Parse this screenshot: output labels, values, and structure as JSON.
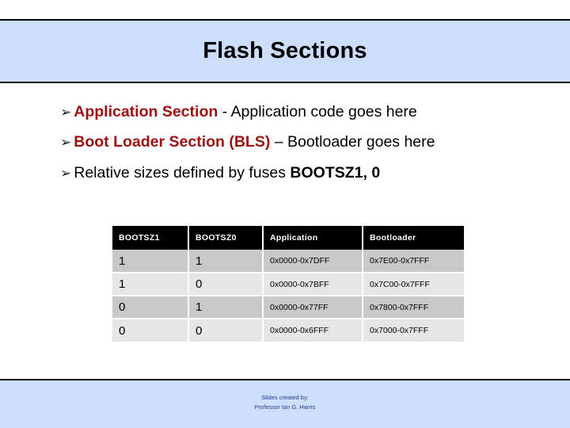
{
  "slide": {
    "title": "Flash Sections",
    "bullet_glyph": "➢",
    "accent_red": "#9e1010",
    "band_color": "#cddefc",
    "bullets": [
      {
        "lead": "Application Section",
        "lead_style": "red-bold",
        "rest": " - Application code goes here",
        "tail": "",
        "tail_style": "none"
      },
      {
        "lead": "Boot Loader Section (BLS)",
        "lead_style": "red-bold",
        "rest": " – Bootloader goes here",
        "tail": "",
        "tail_style": "none"
      },
      {
        "lead": "Relative sizes defined by fuses ",
        "lead_style": "plain",
        "rest": "",
        "tail": "BOOTSZ1, 0",
        "tail_style": "bold"
      }
    ]
  },
  "table": {
    "headers": [
      "BOOTSZ1",
      "BOOTSZ0",
      "Application",
      "Bootloader"
    ],
    "rows": [
      [
        "1",
        "1",
        "0x0000-0x7DFF",
        "0x7E00-0x7FFF"
      ],
      [
        "1",
        "0",
        "0x0000-0x7BFF",
        "0x7C00-0x7FFF"
      ],
      [
        "0",
        "1",
        "0x0000-0x77FF",
        "0x7800-0x7FFF"
      ],
      [
        "0",
        "0",
        "0x0000-0x6FFF",
        "0x7000-0x7FFF"
      ]
    ]
  },
  "footer": {
    "line1": "Slides created by:",
    "line2": "Professor Ian G. Harris"
  }
}
